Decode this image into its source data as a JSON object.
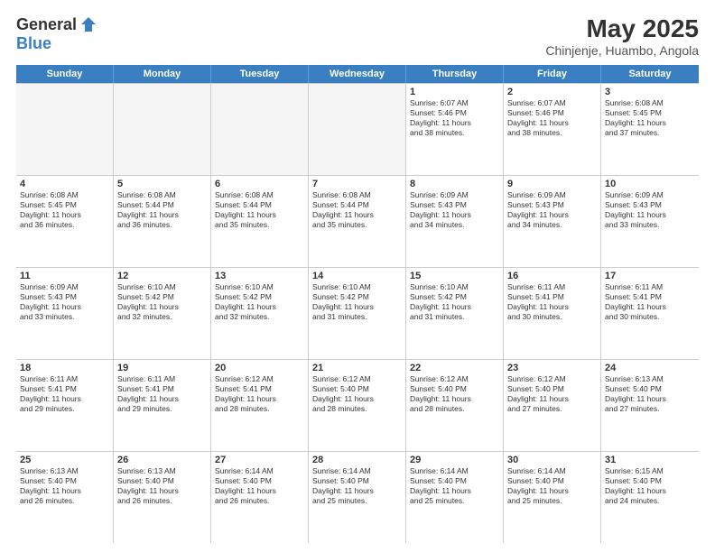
{
  "logo": {
    "general": "General",
    "blue": "Blue"
  },
  "title": "May 2025",
  "location": "Chinjenje, Huambo, Angola",
  "days": [
    "Sunday",
    "Monday",
    "Tuesday",
    "Wednesday",
    "Thursday",
    "Friday",
    "Saturday"
  ],
  "weeks": [
    [
      {
        "day": "",
        "info": ""
      },
      {
        "day": "",
        "info": ""
      },
      {
        "day": "",
        "info": ""
      },
      {
        "day": "",
        "info": ""
      },
      {
        "day": "1",
        "info": "Sunrise: 6:07 AM\nSunset: 5:46 PM\nDaylight: 11 hours\nand 38 minutes."
      },
      {
        "day": "2",
        "info": "Sunrise: 6:07 AM\nSunset: 5:46 PM\nDaylight: 11 hours\nand 38 minutes."
      },
      {
        "day": "3",
        "info": "Sunrise: 6:08 AM\nSunset: 5:45 PM\nDaylight: 11 hours\nand 37 minutes."
      }
    ],
    [
      {
        "day": "4",
        "info": "Sunrise: 6:08 AM\nSunset: 5:45 PM\nDaylight: 11 hours\nand 36 minutes."
      },
      {
        "day": "5",
        "info": "Sunrise: 6:08 AM\nSunset: 5:44 PM\nDaylight: 11 hours\nand 36 minutes."
      },
      {
        "day": "6",
        "info": "Sunrise: 6:08 AM\nSunset: 5:44 PM\nDaylight: 11 hours\nand 35 minutes."
      },
      {
        "day": "7",
        "info": "Sunrise: 6:08 AM\nSunset: 5:44 PM\nDaylight: 11 hours\nand 35 minutes."
      },
      {
        "day": "8",
        "info": "Sunrise: 6:09 AM\nSunset: 5:43 PM\nDaylight: 11 hours\nand 34 minutes."
      },
      {
        "day": "9",
        "info": "Sunrise: 6:09 AM\nSunset: 5:43 PM\nDaylight: 11 hours\nand 34 minutes."
      },
      {
        "day": "10",
        "info": "Sunrise: 6:09 AM\nSunset: 5:43 PM\nDaylight: 11 hours\nand 33 minutes."
      }
    ],
    [
      {
        "day": "11",
        "info": "Sunrise: 6:09 AM\nSunset: 5:43 PM\nDaylight: 11 hours\nand 33 minutes."
      },
      {
        "day": "12",
        "info": "Sunrise: 6:10 AM\nSunset: 5:42 PM\nDaylight: 11 hours\nand 32 minutes."
      },
      {
        "day": "13",
        "info": "Sunrise: 6:10 AM\nSunset: 5:42 PM\nDaylight: 11 hours\nand 32 minutes."
      },
      {
        "day": "14",
        "info": "Sunrise: 6:10 AM\nSunset: 5:42 PM\nDaylight: 11 hours\nand 31 minutes."
      },
      {
        "day": "15",
        "info": "Sunrise: 6:10 AM\nSunset: 5:42 PM\nDaylight: 11 hours\nand 31 minutes."
      },
      {
        "day": "16",
        "info": "Sunrise: 6:11 AM\nSunset: 5:41 PM\nDaylight: 11 hours\nand 30 minutes."
      },
      {
        "day": "17",
        "info": "Sunrise: 6:11 AM\nSunset: 5:41 PM\nDaylight: 11 hours\nand 30 minutes."
      }
    ],
    [
      {
        "day": "18",
        "info": "Sunrise: 6:11 AM\nSunset: 5:41 PM\nDaylight: 11 hours\nand 29 minutes."
      },
      {
        "day": "19",
        "info": "Sunrise: 6:11 AM\nSunset: 5:41 PM\nDaylight: 11 hours\nand 29 minutes."
      },
      {
        "day": "20",
        "info": "Sunrise: 6:12 AM\nSunset: 5:41 PM\nDaylight: 11 hours\nand 28 minutes."
      },
      {
        "day": "21",
        "info": "Sunrise: 6:12 AM\nSunset: 5:40 PM\nDaylight: 11 hours\nand 28 minutes."
      },
      {
        "day": "22",
        "info": "Sunrise: 6:12 AM\nSunset: 5:40 PM\nDaylight: 11 hours\nand 28 minutes."
      },
      {
        "day": "23",
        "info": "Sunrise: 6:12 AM\nSunset: 5:40 PM\nDaylight: 11 hours\nand 27 minutes."
      },
      {
        "day": "24",
        "info": "Sunrise: 6:13 AM\nSunset: 5:40 PM\nDaylight: 11 hours\nand 27 minutes."
      }
    ],
    [
      {
        "day": "25",
        "info": "Sunrise: 6:13 AM\nSunset: 5:40 PM\nDaylight: 11 hours\nand 26 minutes."
      },
      {
        "day": "26",
        "info": "Sunrise: 6:13 AM\nSunset: 5:40 PM\nDaylight: 11 hours\nand 26 minutes."
      },
      {
        "day": "27",
        "info": "Sunrise: 6:14 AM\nSunset: 5:40 PM\nDaylight: 11 hours\nand 26 minutes."
      },
      {
        "day": "28",
        "info": "Sunrise: 6:14 AM\nSunset: 5:40 PM\nDaylight: 11 hours\nand 25 minutes."
      },
      {
        "day": "29",
        "info": "Sunrise: 6:14 AM\nSunset: 5:40 PM\nDaylight: 11 hours\nand 25 minutes."
      },
      {
        "day": "30",
        "info": "Sunrise: 6:14 AM\nSunset: 5:40 PM\nDaylight: 11 hours\nand 25 minutes."
      },
      {
        "day": "31",
        "info": "Sunrise: 6:15 AM\nSunset: 5:40 PM\nDaylight: 11 hours\nand 24 minutes."
      }
    ]
  ]
}
